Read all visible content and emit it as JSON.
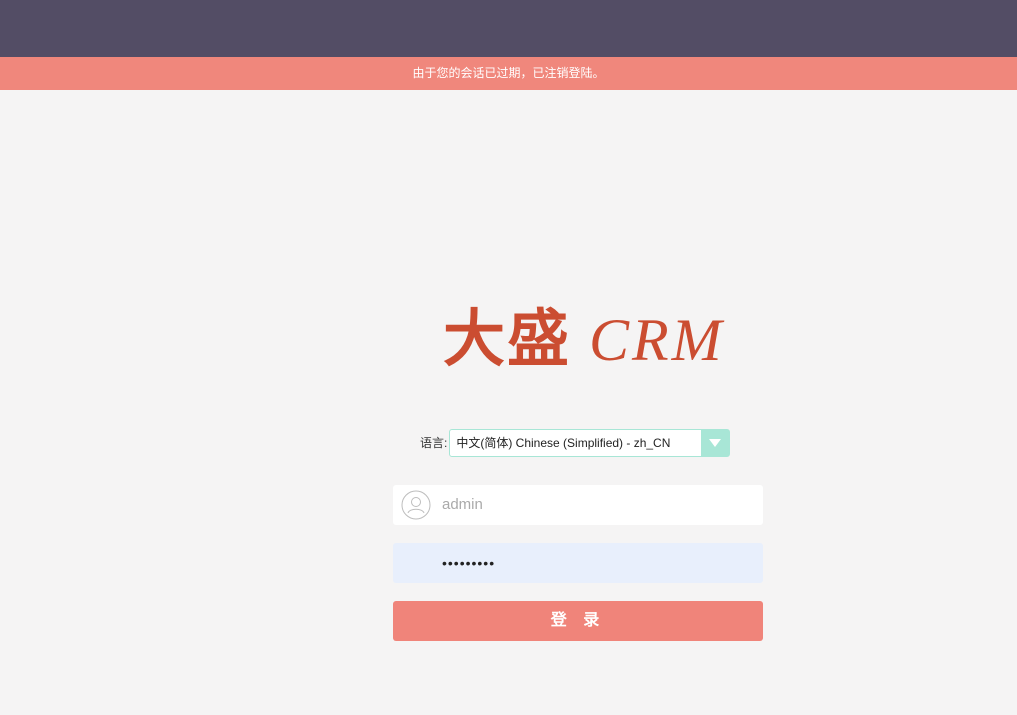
{
  "alert": {
    "message": "由于您的会话已过期，已注销登陆。"
  },
  "logo": {
    "chinese": "大盛",
    "english": "CRM"
  },
  "language": {
    "label": "语言:",
    "selected": "中文(简体) Chinese (Simplified) - zh_CN"
  },
  "login": {
    "username": "admin",
    "password_mask": "•••••••••",
    "submit_label": "登 录"
  },
  "colors": {
    "top_bar": "#534d65",
    "alert": "#f0877c",
    "logo": "#cb4d31",
    "button": "#f0847a",
    "select_accent": "#a8e6d6"
  },
  "icons": {
    "username": "user-icon",
    "dropdown": "chevron-down-icon"
  }
}
